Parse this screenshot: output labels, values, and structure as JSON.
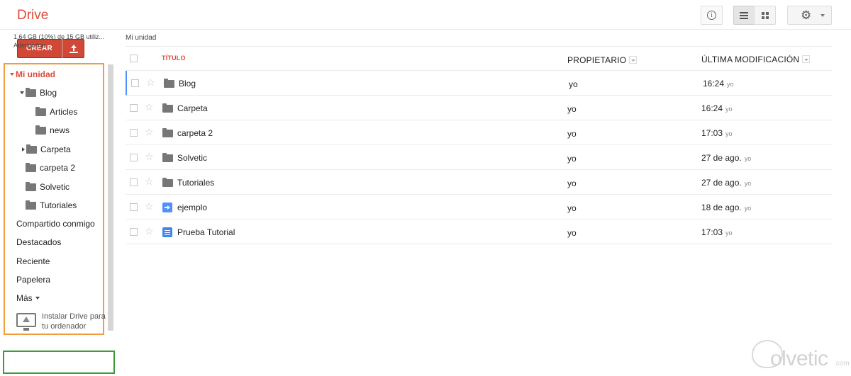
{
  "header": {
    "app_title": "Drive",
    "info_icon": "info-icon",
    "list_view_icon": "list-view-icon",
    "grid_view_icon": "grid-view-icon",
    "settings_icon": "gear-icon"
  },
  "sidebar": {
    "create_label": "CREAR",
    "upload_icon": "upload-icon",
    "nav": {
      "my_drive": "Mi unidad",
      "blog": "Blog",
      "articles": "Articles",
      "news": "news",
      "carpeta": "Carpeta",
      "carpeta2": "carpeta 2",
      "solvetic": "Solvetic",
      "tutoriales": "Tutoriales",
      "shared": "Compartido conmigo",
      "starred": "Destacados",
      "recent": "Reciente",
      "trash": "Papelera",
      "more": "Más"
    },
    "install": "Instalar Drive para tu ordenador",
    "storage": "1,64 GB (10%) de 15 GB utiliz...",
    "manage": "Administrar",
    "nav_box_color": "#f39c3b",
    "storage_box_color": "#3a9d3a"
  },
  "main": {
    "breadcrumb": "Mi unidad",
    "columns": {
      "title": "TÍTULO",
      "owner": "PROPIETARIO",
      "modified": "ÚLTIMA MODIFICACIÓN"
    },
    "rows": [
      {
        "name": "Blog",
        "owner": "yo",
        "modified": "16:24",
        "by": "yo",
        "icon": "folder-icon"
      },
      {
        "name": "Carpeta",
        "owner": "yo",
        "modified": "16:24",
        "by": "yo",
        "icon": "folder-icon"
      },
      {
        "name": "carpeta 2",
        "owner": "yo",
        "modified": "17:03",
        "by": "yo",
        "icon": "folder-icon"
      },
      {
        "name": "Solvetic",
        "owner": "yo",
        "modified": "27 de ago.",
        "by": "yo",
        "icon": "folder-icon"
      },
      {
        "name": "Tutoriales",
        "owner": "yo",
        "modified": "27 de ago.",
        "by": "yo",
        "icon": "folder-icon"
      },
      {
        "name": "ejemplo",
        "owner": "yo",
        "modified": "18 de ago.",
        "by": "yo",
        "icon": "form-icon"
      },
      {
        "name": "Prueba Tutorial",
        "owner": "yo",
        "modified": "17:03",
        "by": "yo",
        "icon": "document-icon"
      }
    ]
  },
  "watermark": {
    "text": "olvetic",
    "suffix": ".com"
  },
  "colors": {
    "brand_red": "#dd4b39",
    "button_red": "#d14836",
    "selected_row_accent": "#4d90fe"
  }
}
